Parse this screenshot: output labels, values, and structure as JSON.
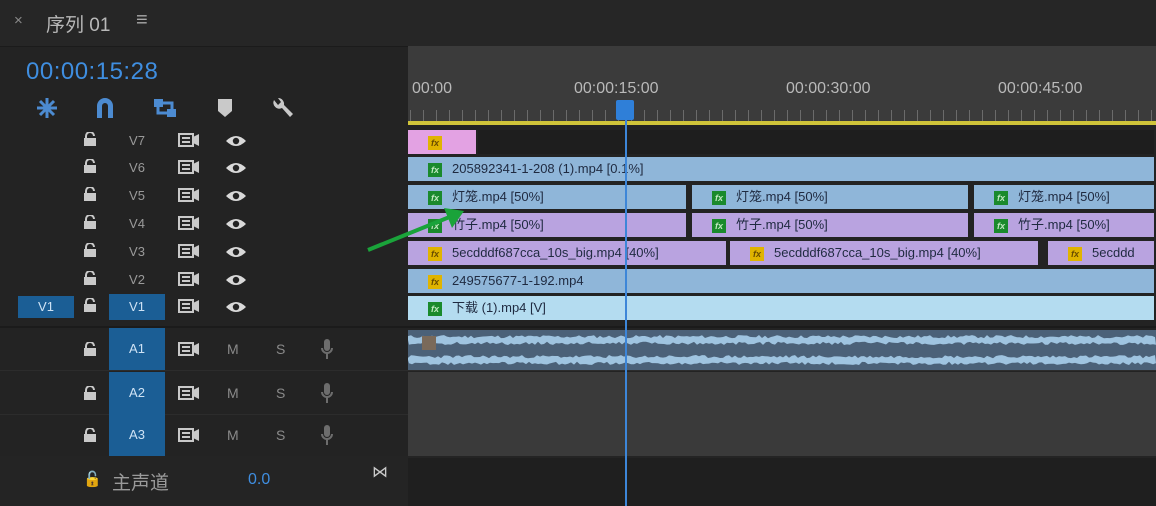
{
  "tab": {
    "close_glyph": "×",
    "title": "序列 01",
    "menu_glyph": "≡"
  },
  "timecode": "00:00:15:28",
  "tools": [
    "snap-icon",
    "magnet-icon",
    "linked-selection-icon",
    "marker-icon",
    "wrench-icon"
  ],
  "ruler": {
    "labels": [
      "00:00",
      "00:00:15:00",
      "00:00:30:00",
      "00:00:45:00"
    ]
  },
  "video_tracks": [
    {
      "name": "V7",
      "clips": [
        {
          "label": "",
          "fx": "fx",
          "color": "#e3a2e3",
          "fxcolor": "y"
        }
      ]
    },
    {
      "name": "V6",
      "clips": [
        {
          "label": "205892341-1-208 (1).mp4 [0.1%]",
          "fx": "fx",
          "color": "#8fb6d9",
          "fxcolor": "g"
        }
      ]
    },
    {
      "name": "V5",
      "clips": [
        {
          "label": "灯笼.mp4 [50%]",
          "fx": "fx",
          "color": "#8fb6d9",
          "fxcolor": "g"
        },
        {
          "label": "灯笼.mp4 [50%]",
          "fx": "fx",
          "color": "#8fb6d9",
          "fxcolor": "g"
        },
        {
          "label": "灯笼.mp4 [50%]",
          "fx": "fx",
          "color": "#8fb6d9",
          "fxcolor": "g"
        }
      ]
    },
    {
      "name": "V4",
      "clips": [
        {
          "label": "竹子.mp4 [50%]",
          "fx": "fx",
          "color": "#b9a3e0",
          "fxcolor": "g"
        },
        {
          "label": "竹子.mp4 [50%]",
          "fx": "fx",
          "color": "#b9a3e0",
          "fxcolor": "g"
        },
        {
          "label": "竹子.mp4 [50%]",
          "fx": "fx",
          "color": "#b9a3e0",
          "fxcolor": "g"
        }
      ]
    },
    {
      "name": "V3",
      "clips": [
        {
          "label": "5ecdddf687cca_10s_big.mp4 [40%]",
          "fx": "fx",
          "color": "#b9a3e0",
          "fxcolor": "y"
        },
        {
          "label": "5ecdddf687cca_10s_big.mp4 [40%]",
          "fx": "fx",
          "color": "#b9a3e0",
          "fxcolor": "y"
        },
        {
          "label": "5ecddd",
          "fx": "fx",
          "color": "#b9a3e0",
          "fxcolor": "y"
        }
      ]
    },
    {
      "name": "V2",
      "clips": [
        {
          "label": "249575677-1-192.mp4",
          "fx": "fx",
          "color": "#8fb6d9",
          "fxcolor": "y"
        }
      ]
    },
    {
      "name": "V1",
      "source": "V1",
      "clips": [
        {
          "label": "下载 (1).mp4 [V]",
          "fx": "fx",
          "color": "#b4dcf0",
          "fxcolor": "g"
        }
      ]
    }
  ],
  "audio_tracks": [
    {
      "name": "A1",
      "m": "M",
      "s": "S"
    },
    {
      "name": "A2",
      "m": "M",
      "s": "S"
    },
    {
      "name": "A3",
      "m": "M",
      "s": "S"
    }
  ],
  "master": {
    "label": "主声道",
    "value": "0.0"
  },
  "colors": {
    "accent": "#3f8ee0",
    "playhead": "#3d86d8",
    "workarea": "#d0c43a",
    "annotation_arrow": "#1aa33a"
  }
}
